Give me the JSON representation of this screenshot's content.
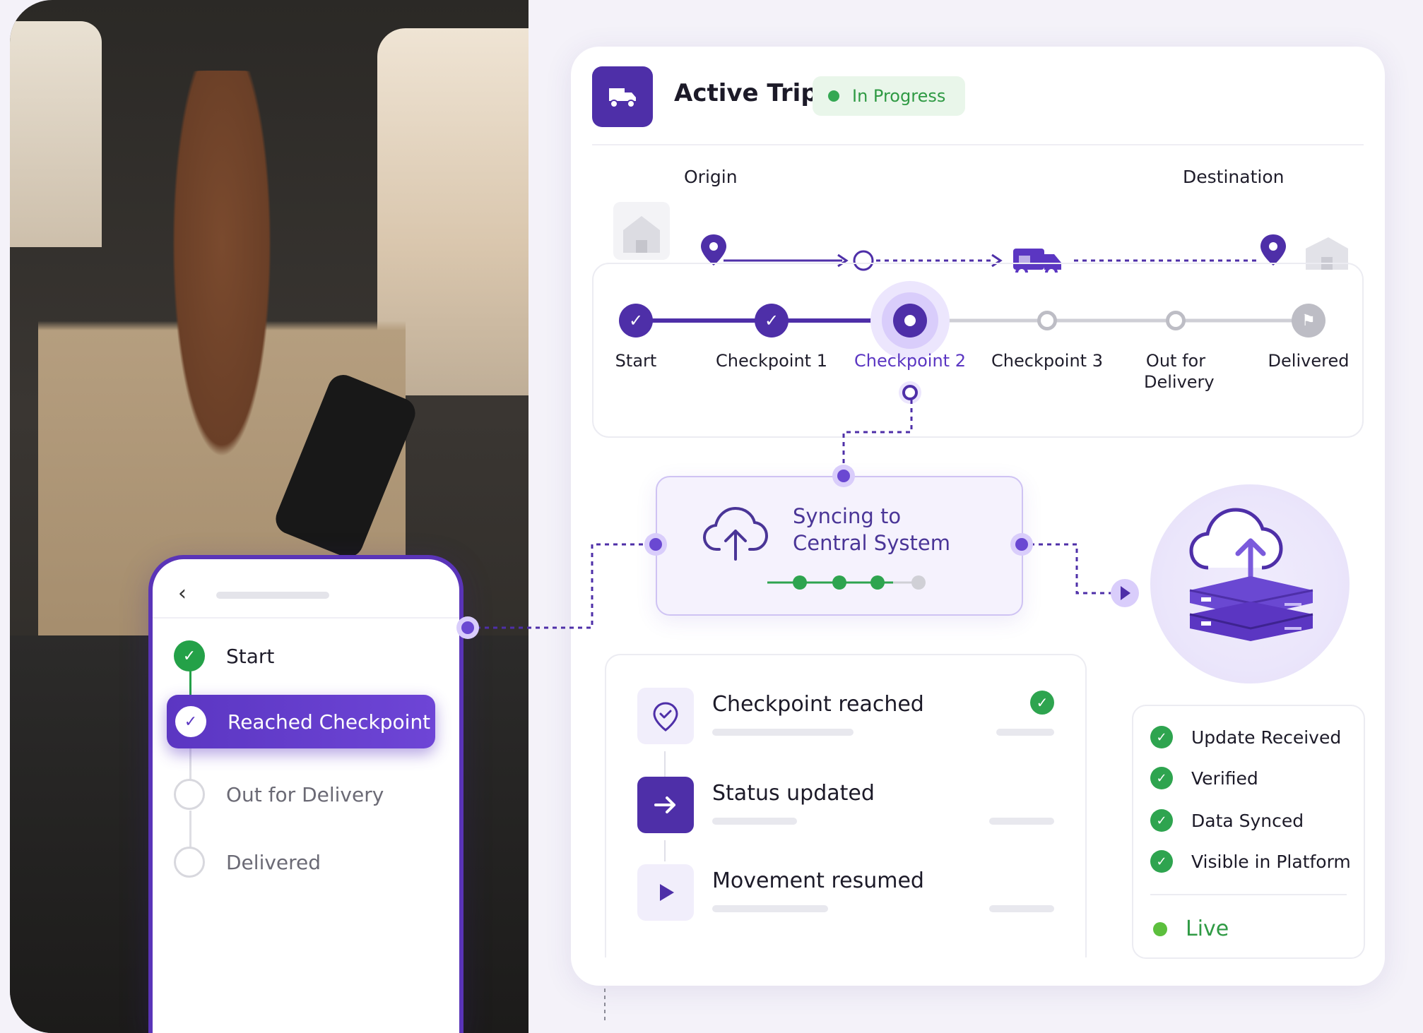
{
  "trip": {
    "title": "Active Trip",
    "status": "In Progress",
    "status_color": "#34a853"
  },
  "route": {
    "origin_label": "Origin",
    "destination_label": "Destination"
  },
  "stepper": {
    "steps": [
      {
        "label": "Start",
        "state": "done"
      },
      {
        "label": "Checkpoint 1",
        "state": "done"
      },
      {
        "label": "Checkpoint 2",
        "state": "active"
      },
      {
        "label": "Checkpoint 3",
        "state": "pending"
      },
      {
        "label": "Out for Delivery",
        "state": "pending"
      },
      {
        "label": "Delivered",
        "state": "pending"
      }
    ]
  },
  "sync": {
    "line1": "Syncing to",
    "line2": "Central System"
  },
  "activity": [
    {
      "title": "Checkpoint reached",
      "icon": "location-check-icon",
      "done": true
    },
    {
      "title": "Status updated",
      "icon": "arrow-right-icon",
      "done": false
    },
    {
      "title": "Movement resumed",
      "icon": "play-icon",
      "done": false
    }
  ],
  "status_list": {
    "items": [
      "Update Received",
      "Verified",
      "Data Synced",
      "Visible in Platform"
    ],
    "live": "Live"
  },
  "phone": {
    "steps": [
      {
        "label": "Start",
        "state": "done"
      },
      {
        "label": "Reached Checkpoint",
        "state": "active"
      },
      {
        "label": "Out for Delivery",
        "state": "pending"
      },
      {
        "label": "Delivered",
        "state": "pending"
      }
    ]
  },
  "colors": {
    "brand_purple": "#5b36c2",
    "success_green": "#2ea44f",
    "background": "#f4f2f9"
  }
}
